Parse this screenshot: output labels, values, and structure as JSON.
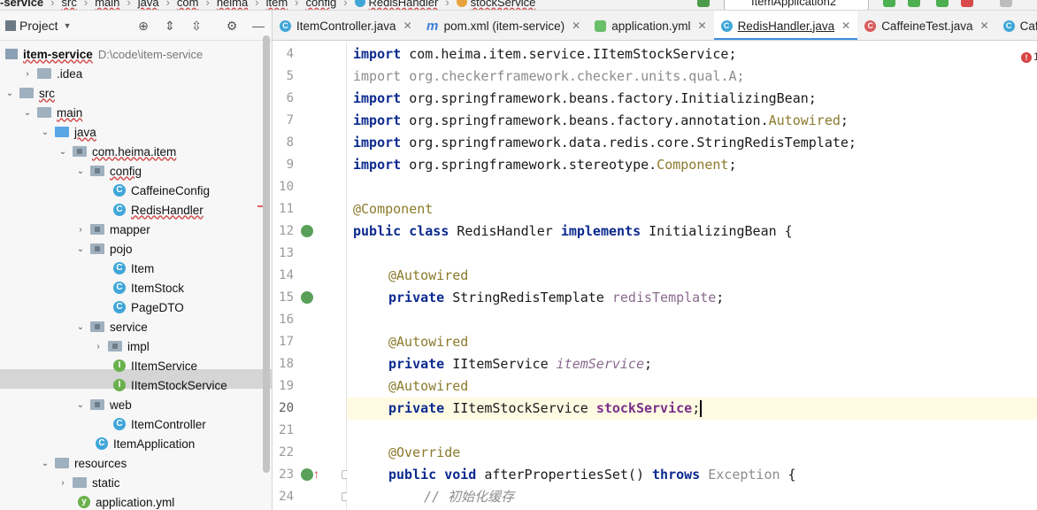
{
  "navbar": {
    "breadcrumbs": [
      "-service",
      "src",
      "main",
      "java",
      "com",
      "heima",
      "item",
      "config",
      "RedisHandler",
      "stockService"
    ],
    "run_config": "ItemApplication2"
  },
  "project": {
    "title": "Project",
    "tree": [
      {
        "label": "item-service",
        "path": "D:\\code\\item-service",
        "type": "module"
      },
      {
        "label": ".idea",
        "type": "folder"
      },
      {
        "label": "src",
        "type": "folder"
      },
      {
        "label": "main",
        "type": "folder"
      },
      {
        "label": "java",
        "type": "folder"
      },
      {
        "label": "com.heima.item",
        "type": "package"
      },
      {
        "label": "config",
        "type": "package"
      },
      {
        "label": "CaffeineConfig",
        "type": "class"
      },
      {
        "label": "RedisHandler",
        "type": "class"
      },
      {
        "label": "mapper",
        "type": "package"
      },
      {
        "label": "pojo",
        "type": "package"
      },
      {
        "label": "Item",
        "type": "class"
      },
      {
        "label": "ItemStock",
        "type": "class"
      },
      {
        "label": "PageDTO",
        "type": "class"
      },
      {
        "label": "service",
        "type": "package"
      },
      {
        "label": "impl",
        "type": "package"
      },
      {
        "label": "IItemService",
        "type": "interface"
      },
      {
        "label": "IItemStockService",
        "type": "interface"
      },
      {
        "label": "web",
        "type": "package"
      },
      {
        "label": "ItemController",
        "type": "class"
      },
      {
        "label": "ItemApplication",
        "type": "class"
      },
      {
        "label": "resources",
        "type": "folder"
      },
      {
        "label": "static",
        "type": "folder"
      },
      {
        "label": "application.yml",
        "type": "file"
      }
    ]
  },
  "tabs": [
    {
      "label": "ItemController.java",
      "icon": "class-icon"
    },
    {
      "label": "pom.xml (item-service)",
      "icon": "maven-icon"
    },
    {
      "label": "application.yml",
      "icon": "yaml-icon"
    },
    {
      "label": "RedisHandler.java",
      "icon": "class-icon",
      "active": true
    },
    {
      "label": "CaffeineTest.java",
      "icon": "class-icon"
    },
    {
      "label": "Caff",
      "icon": "class-icon"
    }
  ],
  "editor": {
    "line_numbers": [
      "4",
      "5",
      "6",
      "7",
      "8",
      "9",
      "10",
      "11",
      "12",
      "13",
      "14",
      "15",
      "16",
      "17",
      "18",
      "19",
      "20",
      "21",
      "22",
      "23",
      "24"
    ],
    "current_line": "20",
    "error_count": "1",
    "code": {
      "l4": [
        "import",
        " com.heima.item.service.IItemStockService;"
      ],
      "l5": [
        "import",
        " org.checkerframework.checker.units.qual.A;"
      ],
      "l6": [
        "import",
        " org.springframework.beans.factory.InitializingBean;"
      ],
      "l7": [
        "import",
        " org.springframework.beans.factory.annotation.",
        "Autowired",
        ";"
      ],
      "l8": [
        "import",
        " org.springframework.data.redis.core.StringRedisTemplate;"
      ],
      "l9": [
        "import",
        " org.springframework.stereotype.",
        "Component",
        ";"
      ],
      "l11": [
        "@Component"
      ],
      "l12": [
        "public class",
        " RedisHandler ",
        "implements",
        " InitializingBean {"
      ],
      "l14": [
        "@Autowired"
      ],
      "l15": [
        "private",
        " StringRedisTemplate ",
        "redisTemplate",
        ";"
      ],
      "l17": [
        "@Autowired"
      ],
      "l18": [
        "private",
        " IItemService ",
        "itemService",
        ";"
      ],
      "l19": [
        "@Autowired"
      ],
      "l20": [
        "private",
        " IItemStockService ",
        "stockService",
        ";"
      ],
      "l22": [
        "@Override"
      ],
      "l23": [
        "public void",
        " afterPropertiesSet() ",
        "throws",
        " Exception",
        " {"
      ],
      "l24": [
        "// 初始化缓存"
      ]
    }
  }
}
